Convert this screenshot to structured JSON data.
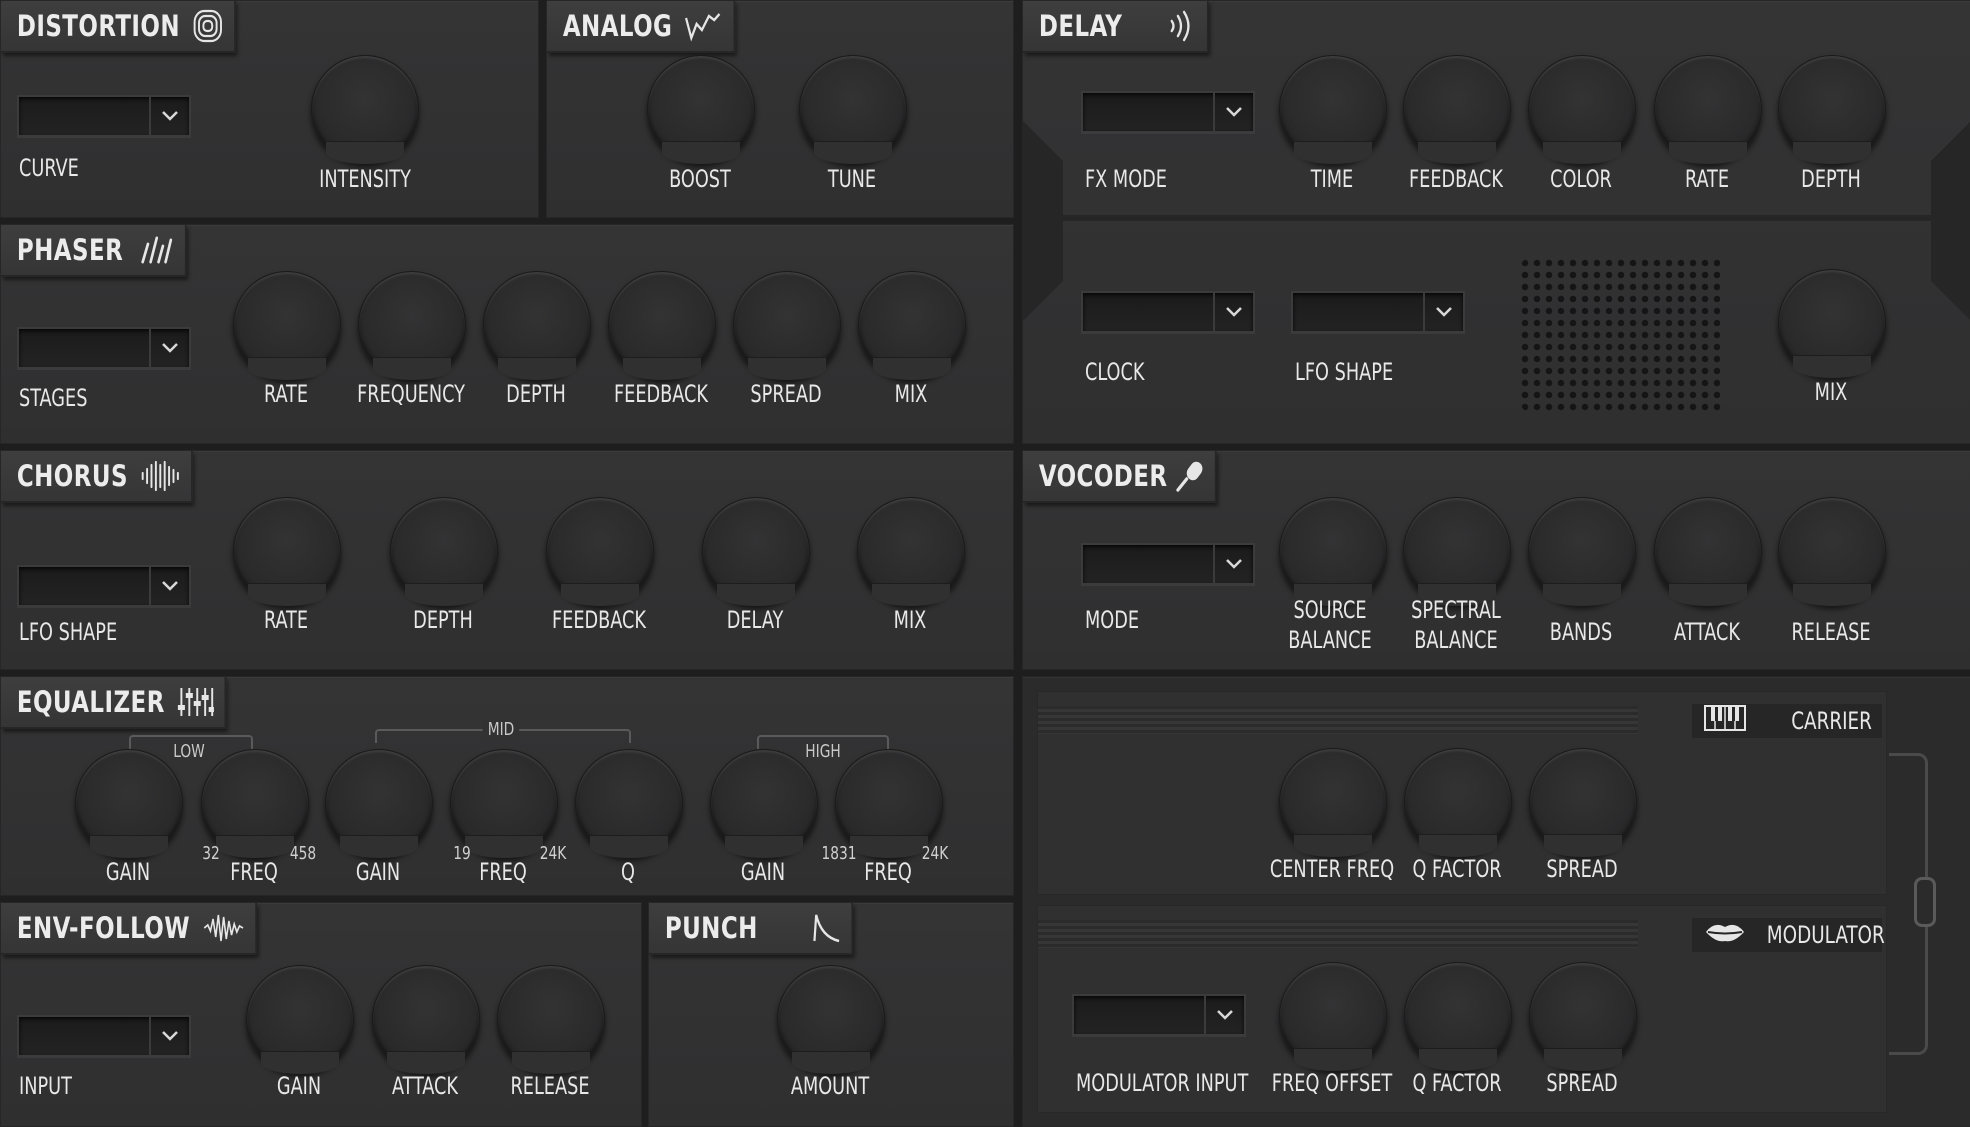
{
  "distortion": {
    "title": "DISTORTION",
    "curve": "CURVE",
    "intensity": "INTENSITY"
  },
  "analog": {
    "title": "ANALOG",
    "boost": "BOOST",
    "tune": "TUNE"
  },
  "phaser": {
    "title": "PHASER",
    "stages": "STAGES",
    "knobs": [
      "RATE",
      "FREQUENCY",
      "DEPTH",
      "FEEDBACK",
      "SPREAD",
      "MIX"
    ]
  },
  "chorus": {
    "title": "CHORUS",
    "lfo_shape": "LFO SHAPE",
    "knobs": [
      "RATE",
      "DEPTH",
      "FEEDBACK",
      "DELAY",
      "MIX"
    ]
  },
  "equalizer": {
    "title": "EQUALIZER",
    "groups": {
      "low": "LOW",
      "mid": "MID",
      "high": "HIGH"
    },
    "knobs": [
      "GAIN",
      "FREQ",
      "GAIN",
      "FREQ",
      "Q",
      "GAIN",
      "FREQ"
    ],
    "ranges": {
      "low_min": "32",
      "low_max": "458",
      "mid_min": "19",
      "mid_max": "24K",
      "high_min": "1831",
      "high_max": "24K"
    }
  },
  "env_follow": {
    "title": "ENV-FOLLOW",
    "input": "INPUT",
    "knobs": [
      "GAIN",
      "ATTACK",
      "RELEASE"
    ]
  },
  "punch": {
    "title": "PUNCH",
    "amount": "AMOUNT"
  },
  "delay": {
    "title": "DELAY",
    "fx_mode": "FX MODE",
    "knobs": [
      "TIME",
      "FEEDBACK",
      "COLOR",
      "RATE",
      "DEPTH"
    ],
    "clock": "CLOCK",
    "lfo_shape": "LFO SHAPE",
    "mix": "MIX"
  },
  "vocoder": {
    "title": "VOCODER",
    "mode": "MODE",
    "source_balance": [
      "SOURCE",
      "BALANCE"
    ],
    "spectral_balance": [
      "SPECTRAL",
      "BALANCE"
    ],
    "bands": "BANDS",
    "attack": "ATTACK",
    "release": "RELEASE",
    "carrier": {
      "label": "CARRIER",
      "knobs": [
        "CENTER FREQ",
        "Q FACTOR",
        "SPREAD"
      ]
    },
    "modulator": {
      "label": "MODULATOR",
      "input": "MODULATOR INPUT",
      "knobs": [
        "FREQ OFFSET",
        "Q FACTOR",
        "SPREAD"
      ]
    }
  }
}
